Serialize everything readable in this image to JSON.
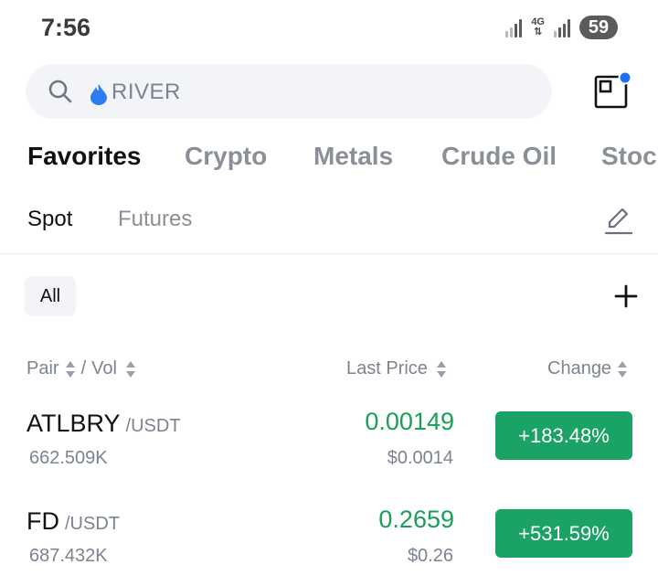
{
  "status_bar": {
    "time": "7:56",
    "network": "4G",
    "battery": "59"
  },
  "search": {
    "placeholder": "RIVER"
  },
  "category_tabs": [
    {
      "label": "Favorites",
      "active": true
    },
    {
      "label": "Crypto",
      "active": false
    },
    {
      "label": "Metals",
      "active": false
    },
    {
      "label": "Crude Oil",
      "active": false
    },
    {
      "label": "Stoc",
      "active": false
    }
  ],
  "sub_tabs": [
    {
      "label": "Spot",
      "active": true
    },
    {
      "label": "Futures",
      "active": false
    }
  ],
  "filter": {
    "label": "All"
  },
  "columns": {
    "pair": "Pair",
    "separator": "/",
    "vol": "Vol",
    "last_price": "Last Price",
    "change": "Change"
  },
  "rows": [
    {
      "base": "ATLBRY",
      "quote": "/USDT",
      "vol": "662.509K",
      "price": "0.00149",
      "price_usd": "$0.0014",
      "change": "+183.48%"
    },
    {
      "base": "FD",
      "quote": "/USDT",
      "vol": "687.432K",
      "price": "0.2659",
      "price_usd": "$0.26",
      "change": "+531.59%"
    }
  ],
  "colors": {
    "positive": "#18a058",
    "positive_badge": "#1aa365",
    "notification_dot": "#1f6ef5",
    "muted_text": "#7c8491"
  },
  "icons": {
    "search": "search-icon",
    "search_prefix": "fire-drop-icon",
    "scan": "scan-icon",
    "edit": "edit-icon",
    "add": "plus-icon",
    "sort": "sort-icon"
  }
}
